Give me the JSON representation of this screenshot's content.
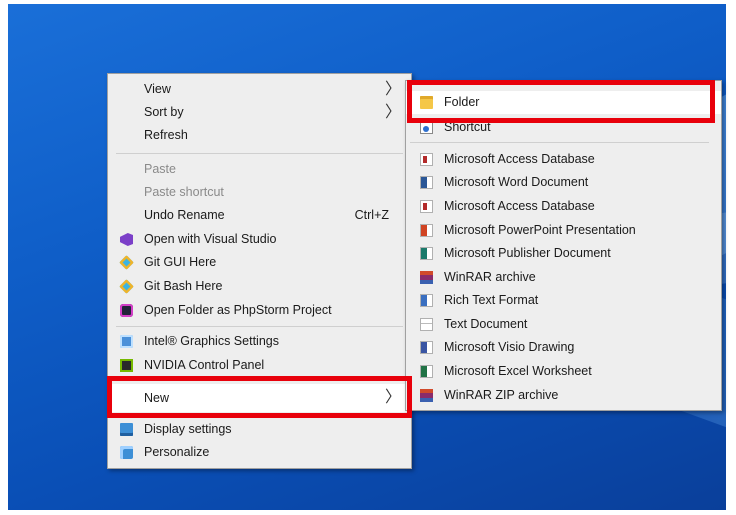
{
  "context_menu": {
    "view": "View",
    "sort_by": "Sort by",
    "refresh": "Refresh",
    "paste": "Paste",
    "paste_shortcut": "Paste shortcut",
    "undo_rename": "Undo Rename",
    "undo_shortcut": "Ctrl+Z",
    "open_visual_studio": "Open with Visual Studio",
    "git_gui": "Git GUI Here",
    "git_bash": "Git Bash Here",
    "phpstorm": "Open Folder as PhpStorm Project",
    "intel": "Intel® Graphics Settings",
    "nvidia": "NVIDIA Control Panel",
    "new": "New",
    "display_settings": "Display settings",
    "personalize": "Personalize",
    "arrow": "〉"
  },
  "new_submenu": {
    "folder": "Folder",
    "shortcut": "Shortcut",
    "items": [
      "Microsoft Access Database",
      "Microsoft Word Document",
      "Microsoft Access Database",
      "Microsoft PowerPoint Presentation",
      "Microsoft Publisher Document",
      "WinRAR archive",
      "Rich Text Format",
      "Text Document",
      "Microsoft Visio Drawing",
      "Microsoft Excel Worksheet",
      "WinRAR ZIP archive"
    ]
  },
  "colors": {
    "highlight_box": "#e8000b",
    "menu_bg": "#eeeeee",
    "desktop_blue": "#0f5ec8"
  }
}
